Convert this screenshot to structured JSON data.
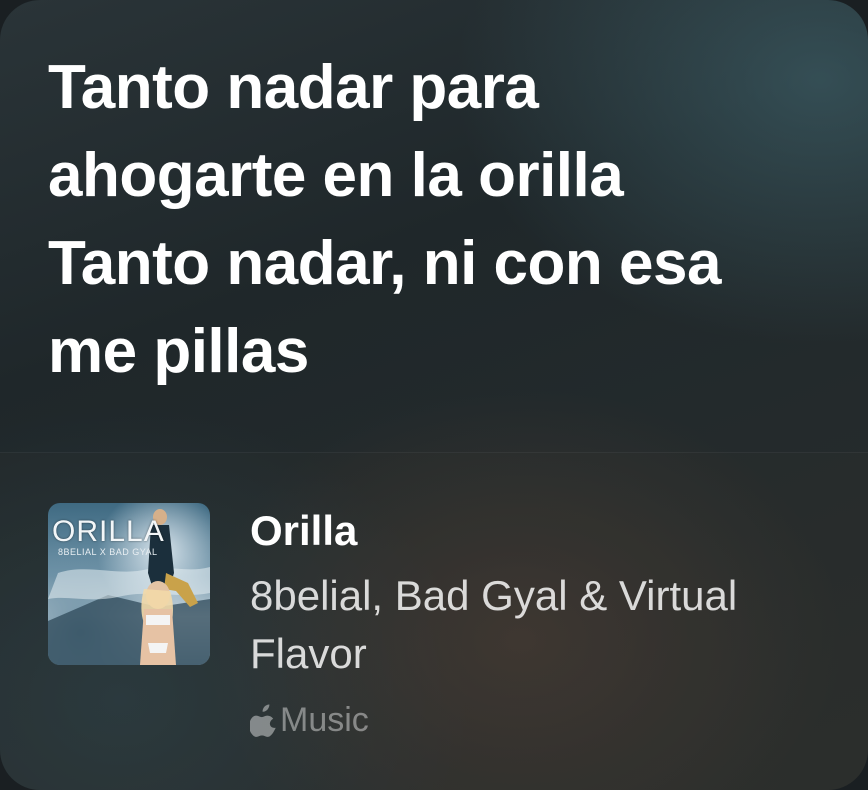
{
  "lyrics": {
    "lines": [
      "Tanto nadar para ahogarte en la orilla",
      "Tanto nadar, ni con esa me pillas"
    ]
  },
  "track": {
    "title": "Orilla",
    "artist": "8belial, Bad Gyal & Virtual Flavor",
    "artwork_title": "ORILLA",
    "artwork_subtitle": "8BELIAL X BAD GYAL"
  },
  "source": {
    "icon": "apple-logo-icon",
    "label": "Music"
  }
}
